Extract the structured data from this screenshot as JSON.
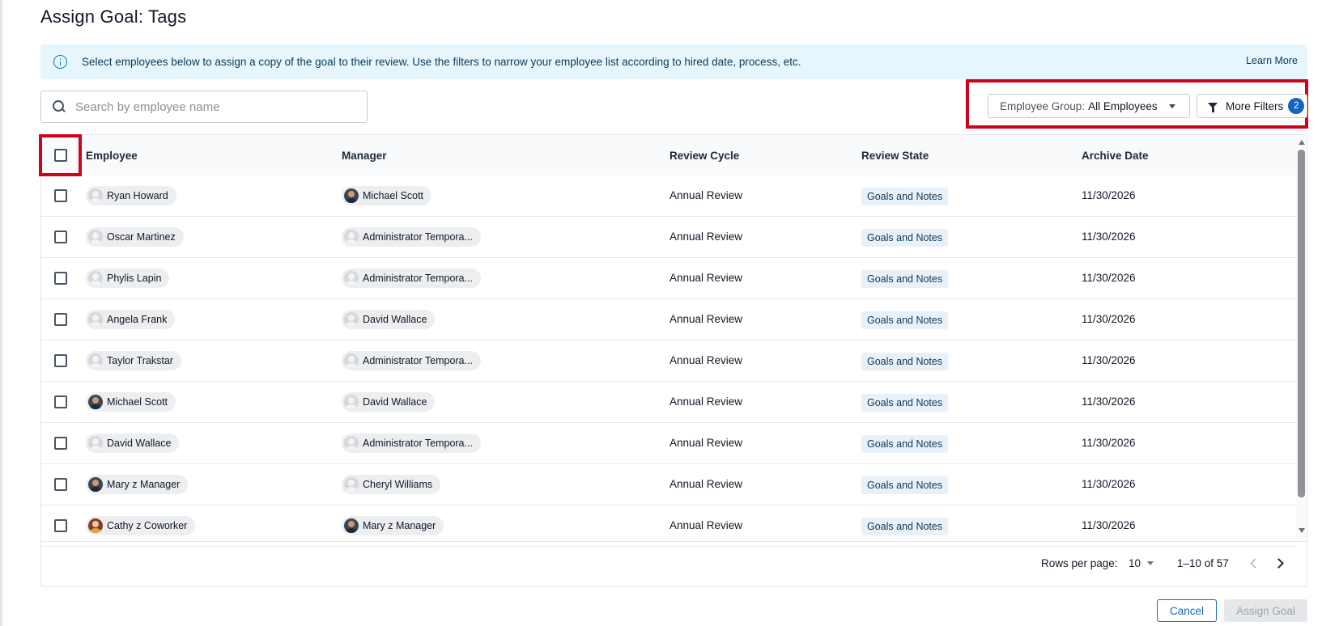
{
  "page": {
    "title": "Assign Goal: Tags"
  },
  "banner": {
    "text": "Select employees below to assign a copy of the goal to their review. Use the filters to narrow your employee list according to hired date, process, etc.",
    "learn_more": "Learn More"
  },
  "search": {
    "placeholder": "Search by employee name",
    "value": ""
  },
  "filters": {
    "group_label": "Employee Group:",
    "group_value": "All Employees",
    "more_filters_label": "More Filters",
    "more_filters_count": "2"
  },
  "table": {
    "columns": [
      "Employee",
      "Manager",
      "Review Cycle",
      "Review State",
      "Archive Date"
    ],
    "rows": [
      {
        "employee": "Ryan Howard",
        "employee_avatar": "placeholder",
        "manager": "Michael Scott",
        "manager_avatar": "photo",
        "cycle": "Annual Review",
        "state": "Goals and Notes",
        "archive": "11/30/2026"
      },
      {
        "employee": "Oscar Martinez",
        "employee_avatar": "placeholder",
        "manager": "Administrator Tempora...",
        "manager_avatar": "placeholder",
        "cycle": "Annual Review",
        "state": "Goals and Notes",
        "archive": "11/30/2026"
      },
      {
        "employee": "Phylis Lapin",
        "employee_avatar": "placeholder",
        "manager": "Administrator Tempora...",
        "manager_avatar": "placeholder",
        "cycle": "Annual Review",
        "state": "Goals and Notes",
        "archive": "11/30/2026"
      },
      {
        "employee": "Angela Frank",
        "employee_avatar": "placeholder",
        "manager": "David Wallace",
        "manager_avatar": "placeholder",
        "cycle": "Annual Review",
        "state": "Goals and Notes",
        "archive": "11/30/2026"
      },
      {
        "employee": "Taylor Trakstar",
        "employee_avatar": "placeholder",
        "manager": "Administrator Tempora...",
        "manager_avatar": "placeholder",
        "cycle": "Annual Review",
        "state": "Goals and Notes",
        "archive": "11/30/2026"
      },
      {
        "employee": "Michael Scott",
        "employee_avatar": "photo",
        "manager": "David Wallace",
        "manager_avatar": "placeholder",
        "cycle": "Annual Review",
        "state": "Goals and Notes",
        "archive": "11/30/2026"
      },
      {
        "employee": "David Wallace",
        "employee_avatar": "placeholder",
        "manager": "Administrator Tempora...",
        "manager_avatar": "placeholder",
        "cycle": "Annual Review",
        "state": "Goals and Notes",
        "archive": "11/30/2026"
      },
      {
        "employee": "Mary z Manager",
        "employee_avatar": "photo",
        "manager": "Cheryl Williams",
        "manager_avatar": "placeholder",
        "cycle": "Annual Review",
        "state": "Goals and Notes",
        "archive": "11/30/2026"
      },
      {
        "employee": "Cathy z Coworker",
        "employee_avatar": "photo2",
        "manager": "Mary z Manager",
        "manager_avatar": "photo",
        "cycle": "Annual Review",
        "state": "Goals and Notes",
        "archive": "11/30/2026"
      }
    ]
  },
  "pagination": {
    "rows_per_page_label": "Rows per page:",
    "rows_per_page_value": "10",
    "range": "1–10 of 57"
  },
  "actions": {
    "cancel": "Cancel",
    "assign": "Assign Goal"
  },
  "icons": {
    "info": "info-icon",
    "search": "search-icon",
    "caret": "caret-down-icon",
    "filter": "funnel-icon",
    "prev": "chevron-left-icon",
    "next": "chevron-right-icon"
  },
  "colors": {
    "accent": "#1565c0",
    "highlight": "#d0021b",
    "banner_bg": "#e6f6fc"
  }
}
